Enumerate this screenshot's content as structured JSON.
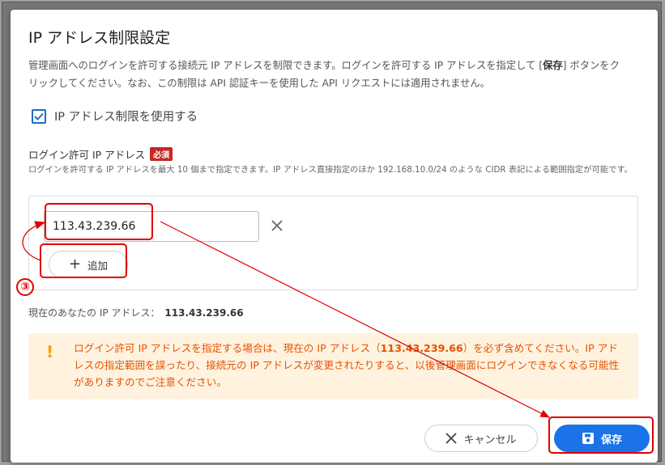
{
  "dialog": {
    "title": "IP アドレス制限設定",
    "desc_part1": "管理画面へのログインを許可する接続元 IP アドレスを制限できます。ログインを許可する IP アドレスを指定して [",
    "desc_bold": "保存",
    "desc_part2": "] ボタンをクリックしてください。なお、この制限は API 認証キーを使用した API リクエストには適用されません。"
  },
  "restriction": {
    "checked": true,
    "label": "IP アドレス制限を使用する"
  },
  "allowed_ips": {
    "label": "ログイン許可 IP アドレス",
    "required_badge": "必須",
    "help": "ログインを許可する IP アドレスを最大 10 個まで指定できます。IP アドレス直接指定のほか 192.168.10.0/24 のような CIDR 表記による範囲指定が可能です。",
    "entries": [
      "113.43.239.66"
    ],
    "add_label": "追加"
  },
  "current_ip": {
    "label": "現在のあなたの IP アドレス：",
    "value": "113.43.239.66"
  },
  "warning": {
    "text_before": "ログイン許可 IP アドレスを指定する場合は、現在の IP アドレス（",
    "ip": "113.43.239.66",
    "text_after": "）を必ず含めてください。IP アドレスの指定範囲を誤ったり、接続元の IP アドレスが変更されたりすると、以後管理画面にログインできなくなる可能性がありますのでご注意ください。"
  },
  "footer": {
    "cancel_label": "キャンセル",
    "save_label": "保存"
  },
  "annotation": {
    "step": "③"
  },
  "colors": {
    "primary": "#1a73e8",
    "annotation_red": "#e00000",
    "warning_bg": "#fff3e0",
    "warning_text": "#e65100",
    "required_badge": "#c62828"
  },
  "icons": [
    "check-icon",
    "close-icon",
    "plus-icon",
    "exclamation-icon",
    "save-disk-icon"
  ]
}
